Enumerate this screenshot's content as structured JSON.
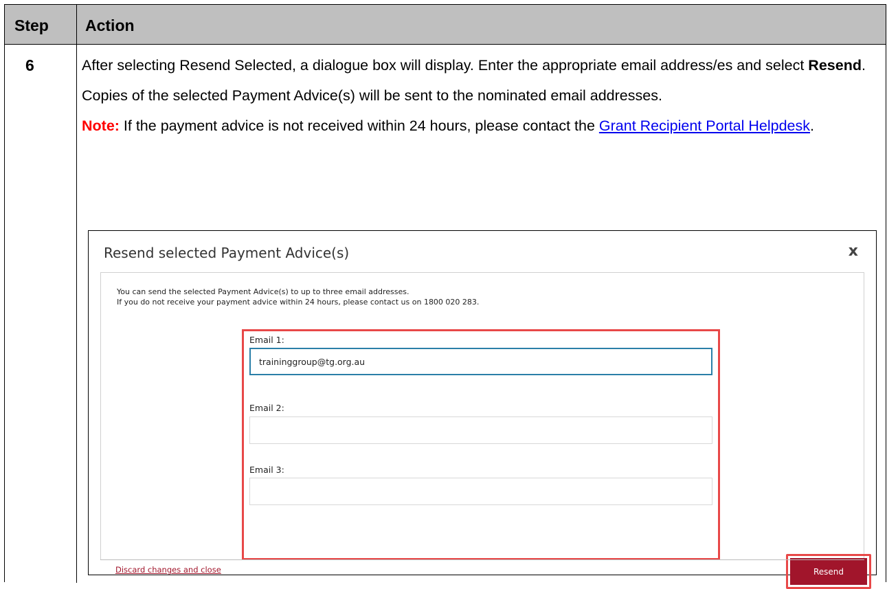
{
  "table": {
    "header_step": "Step",
    "header_action": "Action",
    "step_number": "6"
  },
  "instructions": {
    "para1_text": "After selecting Resend Selected, a dialogue box will display. Enter the appropriate email address/es and select ",
    "para1_bold": "Resend",
    "para1_end": ".",
    "para2": "Copies of the selected Payment Advice(s) will be sent to the nominated email addresses.",
    "note_label": "Note:",
    "note_text": " If the payment advice is not received within 24 hours, please contact the ",
    "note_link": "Grant Recipient Portal Helpdesk",
    "note_end": "."
  },
  "dialog": {
    "title": "Resend selected Payment Advice(s)",
    "close_glyph": "x",
    "info_line1": "You can send the selected Payment Advice(s) to up to three email addresses.",
    "info_line2": "If you do not receive your payment advice within 24 hours, please contact us on 1800 020 283.",
    "email1_label": "Email 1:",
    "email1_value": "traininggroup@tg.org.au",
    "email2_label": "Email 2:",
    "email2_value": "",
    "email3_label": "Email 3:",
    "email3_value": "",
    "discard_label": "Discard changes and close",
    "resend_label": "Resend"
  },
  "colors": {
    "header_bg": "#bfbfbf",
    "note_red": "#ff0000",
    "link_blue": "#0000ee",
    "resend_bg": "#a1152b",
    "highlight_red": "#e84848",
    "active_input_border": "#2a7fa8"
  }
}
